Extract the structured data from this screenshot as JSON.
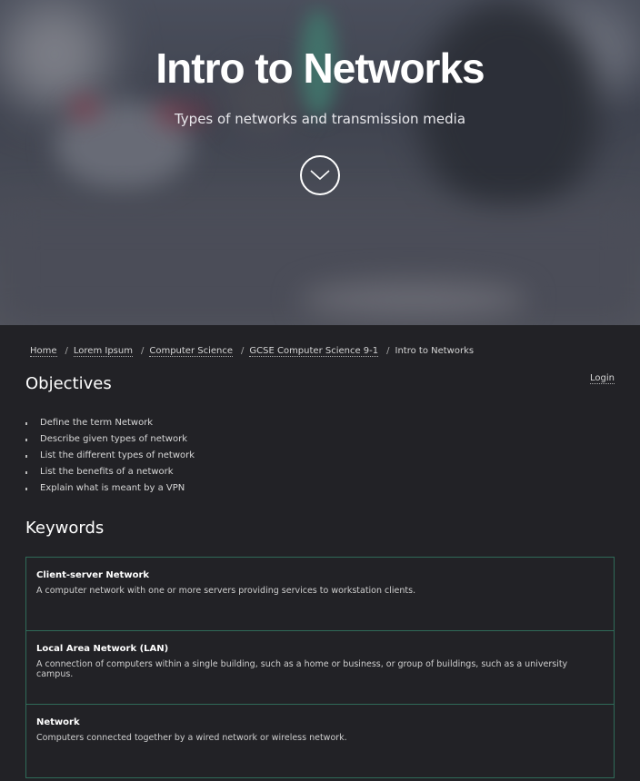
{
  "hero": {
    "title": "Intro to Networks",
    "subtitle": "Types of networks and transmission media",
    "scroll_icon": "chevron-down-icon"
  },
  "breadcrumb": [
    {
      "label": "Home"
    },
    {
      "label": "Lorem Ipsum"
    },
    {
      "label": "Computer Science"
    },
    {
      "label": "GCSE Computer Science 9-1"
    },
    {
      "label": "Intro to Networks"
    }
  ],
  "login_label": "Login",
  "objectives": {
    "heading": "Objectives",
    "items": [
      "Define the term Network",
      "Describe given types of network",
      "List the different types of network",
      "List the benefits of a network",
      "Explain what is meant by a VPN"
    ]
  },
  "keywords": {
    "heading": "Keywords",
    "items": [
      {
        "term": "Client-server Network",
        "definition": "A computer network with one or more servers providing services to workstation clients."
      },
      {
        "term": "Local Area Network (LAN)",
        "definition": "A connection of computers within a single building, such as a home or business, or group of buildings, such as a university campus."
      },
      {
        "term": "Network",
        "definition": "Computers connected together by a wired network or wireless network."
      }
    ]
  },
  "colors": {
    "page_background": "#222226",
    "card_border": "#2f6a58",
    "text": "#ffffff"
  }
}
